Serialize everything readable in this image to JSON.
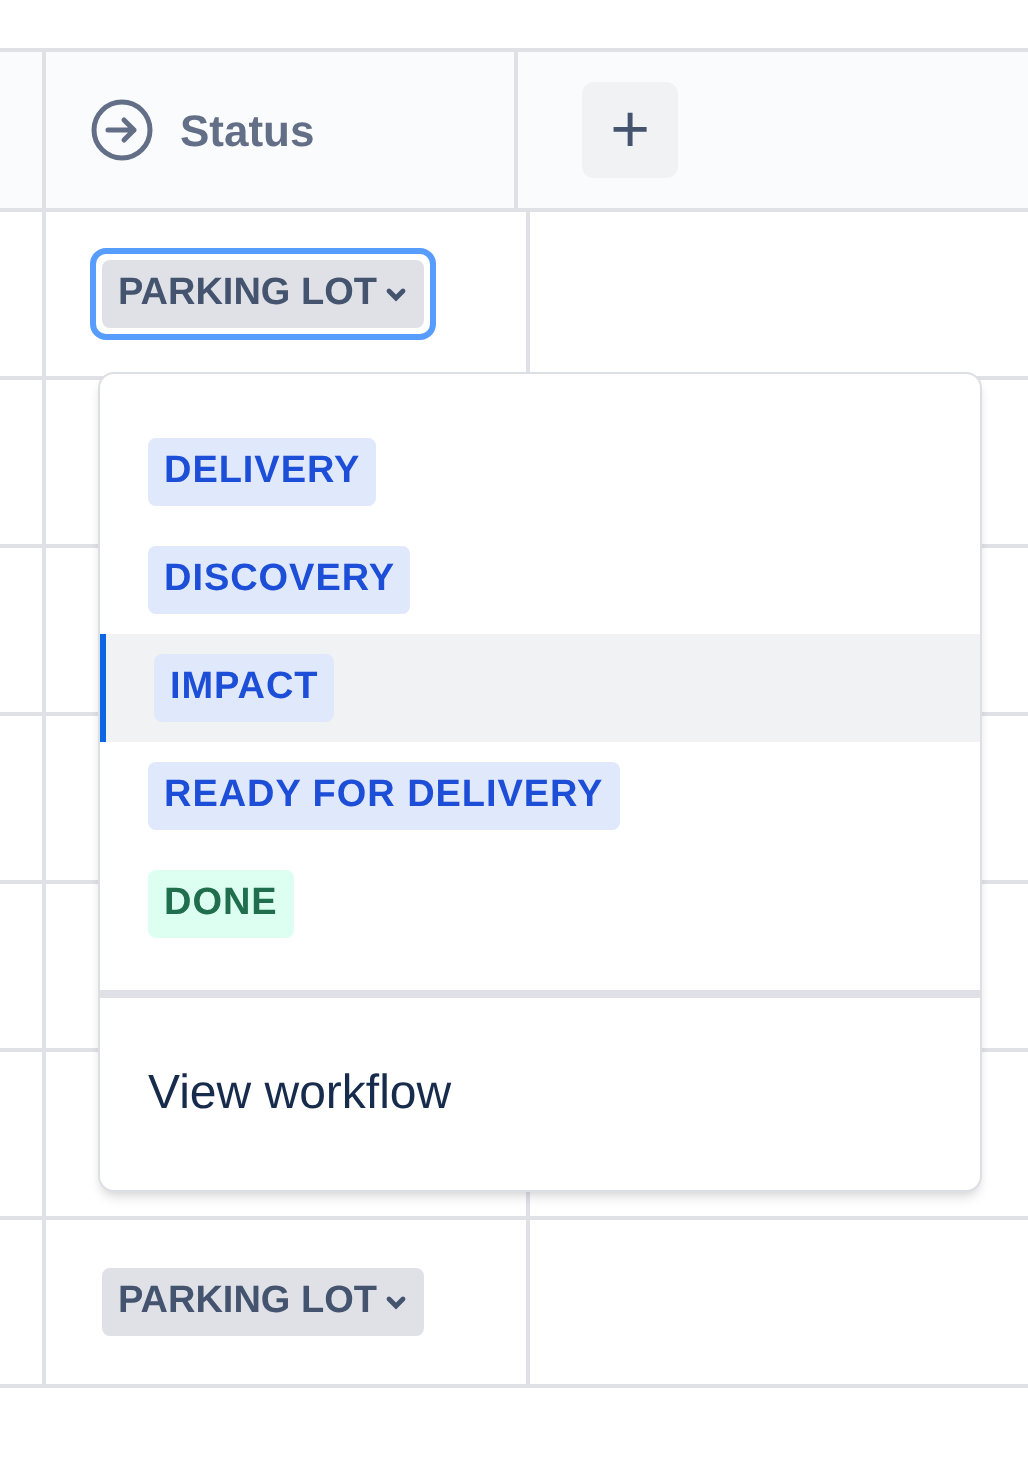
{
  "header": {
    "status_column": "Status",
    "add_column": "+"
  },
  "rows": [
    {
      "status": "PARKING LOT",
      "focused": true
    },
    {},
    {},
    {},
    {},
    {},
    {
      "status": "PARKING LOT",
      "focused": false
    }
  ],
  "dropdown": {
    "options": [
      {
        "label": "DELIVERY",
        "color": "#1d4ed8",
        "selected": false
      },
      {
        "label": "DISCOVERY",
        "color": "#1d4ed8",
        "selected": false
      },
      {
        "label": "IMPACT",
        "color": "#1d4ed8",
        "selected": true
      },
      {
        "label": "READY FOR DELIVERY",
        "color": "#1d4ed8",
        "selected": false
      },
      {
        "label": "DONE",
        "color": "#216e4e",
        "selected": false
      }
    ],
    "footer": "View workflow"
  }
}
